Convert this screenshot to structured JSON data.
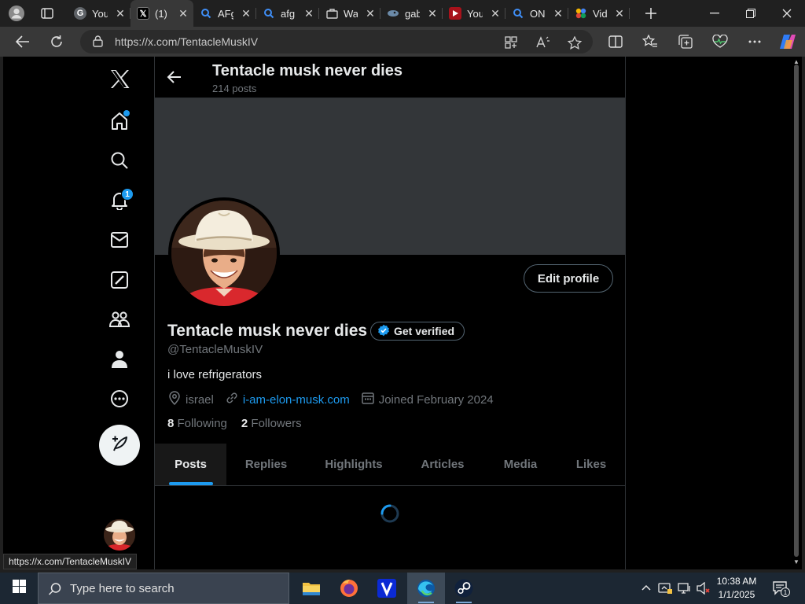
{
  "browser": {
    "tabs": [
      {
        "title": "You",
        "favicon": "google-icon"
      },
      {
        "title": "(1)",
        "favicon": "x-logo-icon"
      },
      {
        "title": "AFg",
        "favicon": "search-icon"
      },
      {
        "title": "afg",
        "favicon": "search-icon"
      },
      {
        "title": "Wa",
        "favicon": "bag-icon"
      },
      {
        "title": "gab",
        "favicon": "gab-icon"
      },
      {
        "title": "You",
        "favicon": "youtube-icon"
      },
      {
        "title": "ON",
        "favicon": "search-icon"
      },
      {
        "title": "Vid",
        "favicon": "colorful-icon"
      }
    ],
    "active_tab_index": 1,
    "url": "https://x.com/TentacleMuskIV",
    "status_url": "https://x.com/TentacleMuskIV"
  },
  "nav": {
    "notifications_badge": "1",
    "items": [
      "x-logo-icon",
      "home-icon",
      "explore-icon",
      "notifications-icon",
      "messages-icon",
      "grok-icon",
      "communities-icon",
      "profile-icon",
      "more-icon"
    ]
  },
  "header": {
    "name": "Tentacle musk never dies",
    "post_count": "214 posts"
  },
  "profile": {
    "display_name": "Tentacle musk never dies",
    "get_verified_label": "Get verified",
    "handle": "@TentacleMuskIV",
    "bio": "i love refrigerators",
    "location": "israel",
    "website": "i-am-elon-musk.com",
    "joined": "Joined February 2024",
    "following_count": "8",
    "following_label": "Following",
    "followers_count": "2",
    "followers_label": "Followers",
    "edit_profile_label": "Edit profile"
  },
  "profile_tabs": [
    "Posts",
    "Replies",
    "Highlights",
    "Articles",
    "Media",
    "Likes"
  ],
  "selected_profile_tab": "Posts",
  "taskbar": {
    "search_placeholder": "Type here to search",
    "apps": [
      "file-explorer-icon",
      "firefox-icon",
      "vivaldi-icon",
      "edge-icon",
      "steam-icon"
    ],
    "time": "10:38 AM",
    "date": "1/1/2025",
    "notification_count": "1"
  },
  "colors": {
    "accent": "#1d9bf0",
    "page_bg": "#000000",
    "banner": "#333639",
    "muted_text": "#71767b"
  }
}
